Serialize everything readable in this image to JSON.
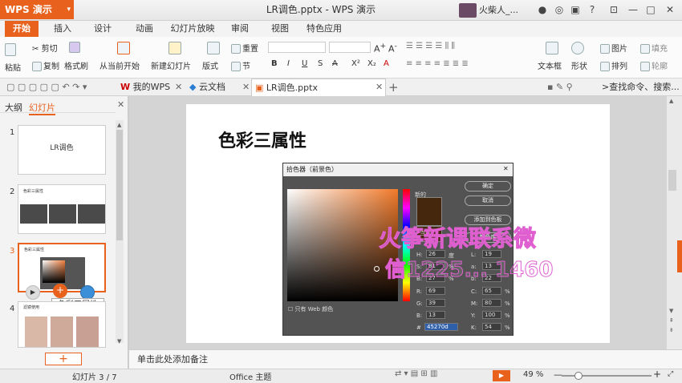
{
  "app": {
    "name": "WPS 演示",
    "window_title": "LR调色.pptx - WPS 演示",
    "user": "火柴人_..."
  },
  "ribbon_tabs": [
    "开始",
    "插入",
    "设计",
    "动画",
    "幻灯片放映",
    "审阅",
    "视图",
    "特色应用"
  ],
  "ribbon": {
    "paste": "粘贴",
    "cut": "剪切",
    "copy": "复制",
    "format_painter": "格式刷",
    "from_current": "从当前开始",
    "new_slide": "新建幻灯片",
    "layout": "版式",
    "reset": "重置",
    "section": "节",
    "text_box": "文本框",
    "shape": "形状",
    "picture": "图片",
    "arrange": "排列",
    "fill": "填充",
    "outline": "轮廓"
  },
  "doc_tabs": [
    "我的WPS",
    "云文档",
    "LR调色.pptx"
  ],
  "search": ">查找命令、搜索...",
  "sidebar": {
    "tabs": [
      "大纲",
      "幻灯片"
    ],
    "thumbs": [
      {
        "num": "1",
        "title": "LR调色"
      },
      {
        "num": "2",
        "title": "色彩三属性"
      },
      {
        "num": "3",
        "title": "色彩三属性"
      },
      {
        "num": "4",
        "title": "滤镜使用"
      }
    ],
    "tooltip": "色彩三属性"
  },
  "slide": {
    "title": "色彩三属性"
  },
  "picker": {
    "title": "拾色器（前景色）",
    "ok": "确定",
    "cancel": "取消",
    "add_swatch": "添加到色板",
    "color_lib": "颜色库",
    "new_label": "新的",
    "current_label": "当前",
    "web_only": "只有 Web 颜色",
    "hsb": [
      {
        "k": "H:",
        "v": "26",
        "u": "度"
      },
      {
        "k": "S:",
        "v": "81",
        "u": "%"
      },
      {
        "k": "B:",
        "v": "27",
        "u": "%"
      }
    ],
    "rgb": [
      {
        "k": "R:",
        "v": "69"
      },
      {
        "k": "G:",
        "v": "39"
      },
      {
        "k": "B:",
        "v": "13"
      }
    ],
    "lab": [
      {
        "k": "L:",
        "v": "19"
      },
      {
        "k": "a:",
        "v": "13"
      },
      {
        "k": "b:",
        "v": "22"
      }
    ],
    "cmyk": [
      {
        "k": "C:",
        "v": "65",
        "u": "%"
      },
      {
        "k": "M:",
        "v": "80",
        "u": "%"
      },
      {
        "k": "Y:",
        "v": "100",
        "u": "%"
      },
      {
        "k": "K:",
        "v": "54",
        "u": "%"
      }
    ],
    "hex_label": "#",
    "hex": "45270d",
    "color": "#45270d"
  },
  "watermark": {
    "line1": "火筝新课联系微",
    "line2": "信1225... 1460"
  },
  "notes_placeholder": "单击此处添加备注",
  "status": {
    "slide_count": "幻灯片 3 / 7",
    "theme": "Office 主题",
    "zoom": "49 %"
  },
  "colors": {
    "accent": "#e8621d"
  }
}
